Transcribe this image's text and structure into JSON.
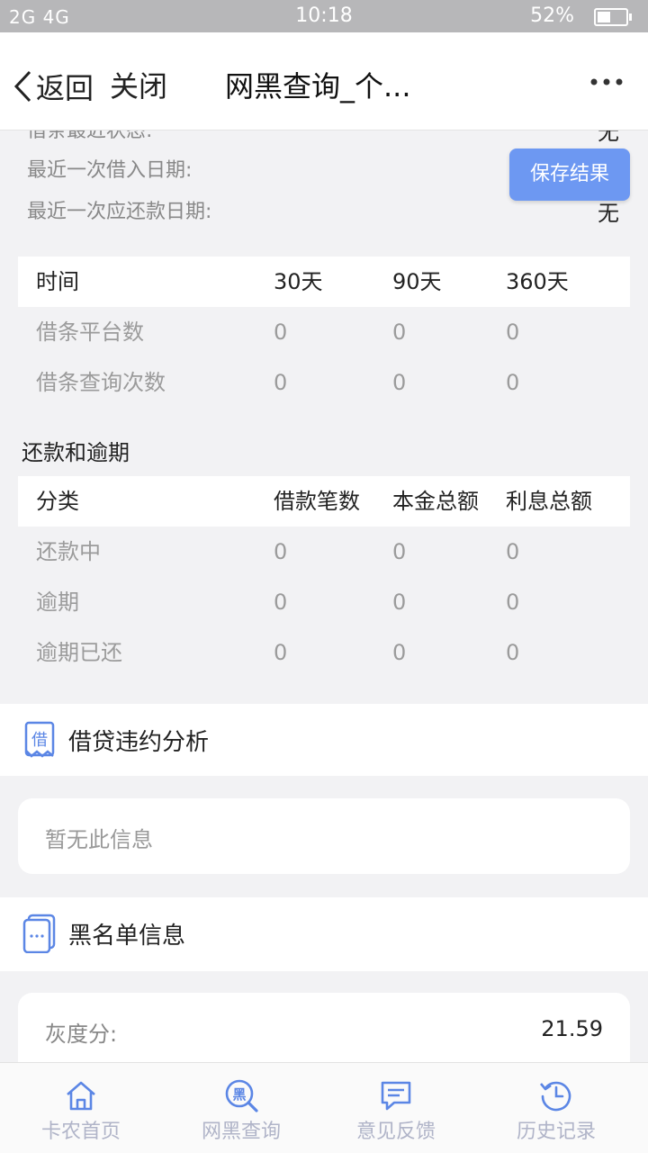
{
  "status_bar": {
    "signal": "2G 4G",
    "time": "10:18",
    "battery": "52%"
  },
  "nav": {
    "back_label": "返回",
    "close_label": "关闭",
    "title": "网黑查询_个..."
  },
  "top_info": {
    "rows": [
      {
        "label": "借条最近状态:",
        "value": "无"
      },
      {
        "label": "最近一次借入日期:",
        "value": ""
      },
      {
        "label": "最近一次应还款日期:",
        "value": "无"
      }
    ],
    "save_button": "保存结果"
  },
  "loan_table": {
    "headers": [
      "时间",
      "30天",
      "90天",
      "360天"
    ],
    "rows": [
      [
        "借条平台数",
        "0",
        "0",
        "0"
      ],
      [
        "借条查询次数",
        "0",
        "0",
        "0"
      ]
    ]
  },
  "repay_section": {
    "title": "还款和逾期",
    "headers": [
      "分类",
      "借款笔数",
      "本金总额",
      "利息总额"
    ],
    "rows": [
      [
        "还款中",
        "0",
        "0",
        "0"
      ],
      [
        "逾期",
        "0",
        "0",
        "0"
      ],
      [
        "逾期已还",
        "0",
        "0",
        "0"
      ]
    ]
  },
  "default_section": {
    "icon_char": "借",
    "title": "借贷违约分析",
    "empty_text": "暂无此信息"
  },
  "blacklist_section": {
    "title": "黑名单信息",
    "gray_score_label": "灰度分:",
    "gray_score_value": "21.59"
  },
  "tabs": [
    {
      "label": "卡农首页",
      "icon": "home-icon"
    },
    {
      "label": "网黑查询",
      "icon": "blacklist-search-icon",
      "icon_char": "黑"
    },
    {
      "label": "意见反馈",
      "icon": "feedback-icon"
    },
    {
      "label": "历史记录",
      "icon": "history-icon"
    }
  ],
  "colors": {
    "accent": "#6d98f2",
    "tab_icon": "#5b86e5",
    "tab_label": "#b0b4c8"
  }
}
